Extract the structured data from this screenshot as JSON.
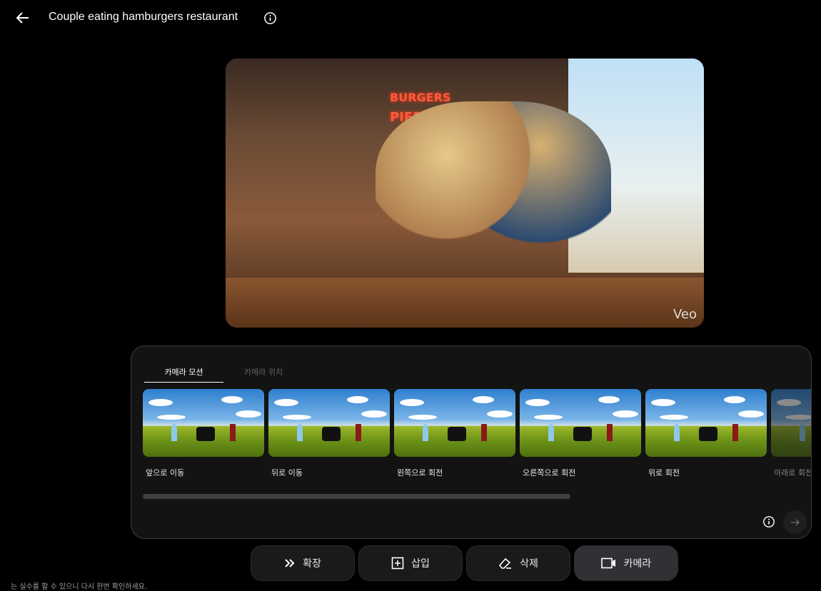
{
  "header": {
    "title": "Couple eating hamburgers restaurant",
    "back_icon": "arrow-left-icon",
    "info_icon": "info-icon"
  },
  "video": {
    "signs": [
      "BURGERS",
      "PIER SIDE"
    ],
    "watermark": "Veo"
  },
  "panel": {
    "tabs": [
      {
        "label": "카메라 모션",
        "active": true
      },
      {
        "label": "카메라 위치",
        "active": false
      }
    ],
    "options": [
      {
        "label": "앞으로 이동"
      },
      {
        "label": "뒤로 이동"
      },
      {
        "label": "왼쪽으로 회전"
      },
      {
        "label": "오른쪽으로 회전"
      },
      {
        "label": "위로 회전"
      },
      {
        "label": "아래로 회전"
      }
    ]
  },
  "toolbar": {
    "extend": "확장",
    "insert": "삽입",
    "remove": "삭제",
    "camera": "카메라"
  },
  "disclaimer": "는 실수를 할 수 있으니 다시 한번 확인하세요."
}
